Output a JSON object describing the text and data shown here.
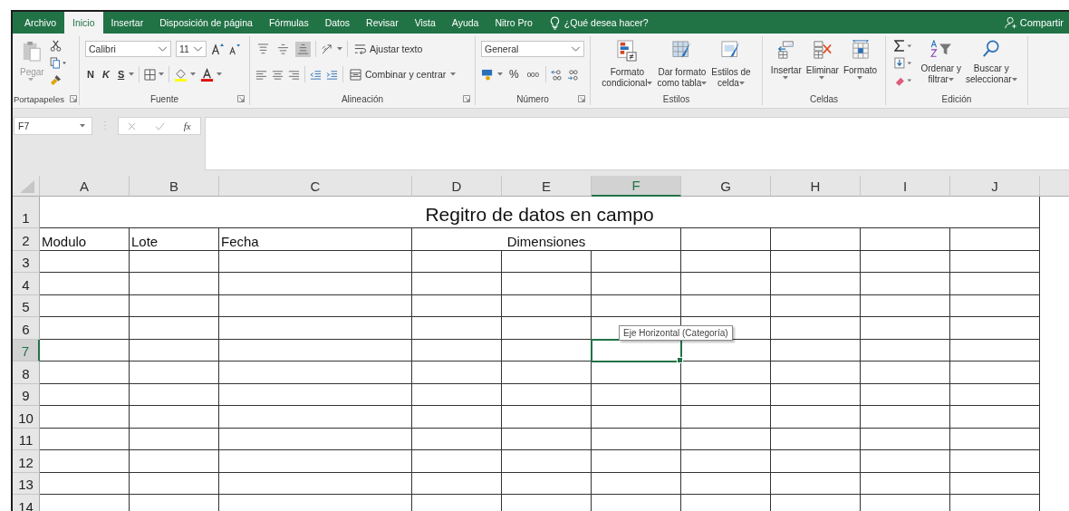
{
  "tabs": [
    {
      "label": "Archivo",
      "selected": false
    },
    {
      "label": "Inicio",
      "selected": true
    },
    {
      "label": "Insertar",
      "selected": false
    },
    {
      "label": "Disposición de página",
      "selected": false
    },
    {
      "label": "Fórmulas",
      "selected": false
    },
    {
      "label": "Datos",
      "selected": false
    },
    {
      "label": "Revisar",
      "selected": false
    },
    {
      "label": "Vista",
      "selected": false
    },
    {
      "label": "Ayuda",
      "selected": false
    },
    {
      "label": "Nitro Pro",
      "selected": false
    }
  ],
  "tell_me": "¿Qué desea hacer?",
  "share": "Compartir",
  "ribbon": {
    "clipboard": {
      "paste": "Pegar",
      "label": "Portapapeles"
    },
    "font": {
      "font_name": "Calibri",
      "font_size": "11",
      "bold": "N",
      "italic": "K",
      "underline": "S",
      "label": "Fuente"
    },
    "alignment": {
      "vertical_align": [
        {
          "selected": false
        },
        {
          "selected": false
        },
        {
          "selected": true
        }
      ],
      "wrap_text": "Ajustar texto",
      "merge": "Combinar y centrar",
      "label": "Alineación"
    },
    "number": {
      "format": "General",
      "percent": "%",
      "thousands": "000",
      "label": "Número"
    },
    "styles": {
      "buttons": [
        {
          "lines": [
            "Formato",
            "condicional"
          ]
        },
        {
          "lines": [
            "Dar formato",
            "como tabla"
          ]
        },
        {
          "lines": [
            "Estilos de",
            "celda"
          ]
        }
      ],
      "label": "Estilos"
    },
    "cells": {
      "buttons": [
        "Insertar",
        "Eliminar",
        "Formato"
      ],
      "label": "Celdas"
    },
    "editing": {
      "buttons": [
        {
          "lines": [
            "Ordenar y",
            "filtrar"
          ]
        },
        {
          "lines": [
            "Buscar y",
            "seleccionar"
          ]
        }
      ],
      "label": "Edición"
    }
  },
  "formula_bar": {
    "name_box": "F7",
    "function": "fx"
  },
  "sheet": {
    "columns": [
      {
        "label": "A",
        "selected": false
      },
      {
        "label": "B",
        "selected": false
      },
      {
        "label": "C",
        "selected": false
      },
      {
        "label": "D",
        "selected": false
      },
      {
        "label": "E",
        "selected": false
      },
      {
        "label": "F",
        "selected": true
      },
      {
        "label": "G",
        "selected": false
      },
      {
        "label": "H",
        "selected": false
      },
      {
        "label": "I",
        "selected": false
      },
      {
        "label": "J",
        "selected": false
      }
    ],
    "rows": [
      {
        "label": "1",
        "selected": false,
        "cells": [
          {
            "text": "Regitro de datos en campo"
          },
          {
            "merged": true
          },
          {
            "merged": true
          },
          {
            "merged": true
          },
          {
            "merged": true
          },
          {
            "merged": true
          },
          {
            "merged": true
          },
          {
            "merged": true
          },
          {
            "merged": true
          },
          {
            "merged": true
          }
        ]
      },
      {
        "label": "2",
        "selected": false,
        "cells": [
          {
            "text": "Modulo"
          },
          {
            "text": "Lote"
          },
          {
            "text": "Fecha"
          },
          {
            "text": "Dimensiones"
          },
          {
            "merged": true
          },
          {
            "merged": true
          }
        ]
      },
      {
        "label": "3",
        "selected": false
      },
      {
        "label": "4",
        "selected": false
      },
      {
        "label": "5",
        "selected": false
      },
      {
        "label": "6",
        "selected": false
      },
      {
        "label": "7",
        "selected": true
      },
      {
        "label": "8",
        "selected": false
      },
      {
        "label": "9",
        "selected": false
      },
      {
        "label": "10",
        "selected": false
      },
      {
        "label": "11",
        "selected": false
      },
      {
        "label": "12",
        "selected": false
      },
      {
        "label": "13",
        "selected": false
      },
      {
        "label": "14",
        "selected": false
      }
    ],
    "tooltip": "Eje Horizontal (Categoría)"
  }
}
